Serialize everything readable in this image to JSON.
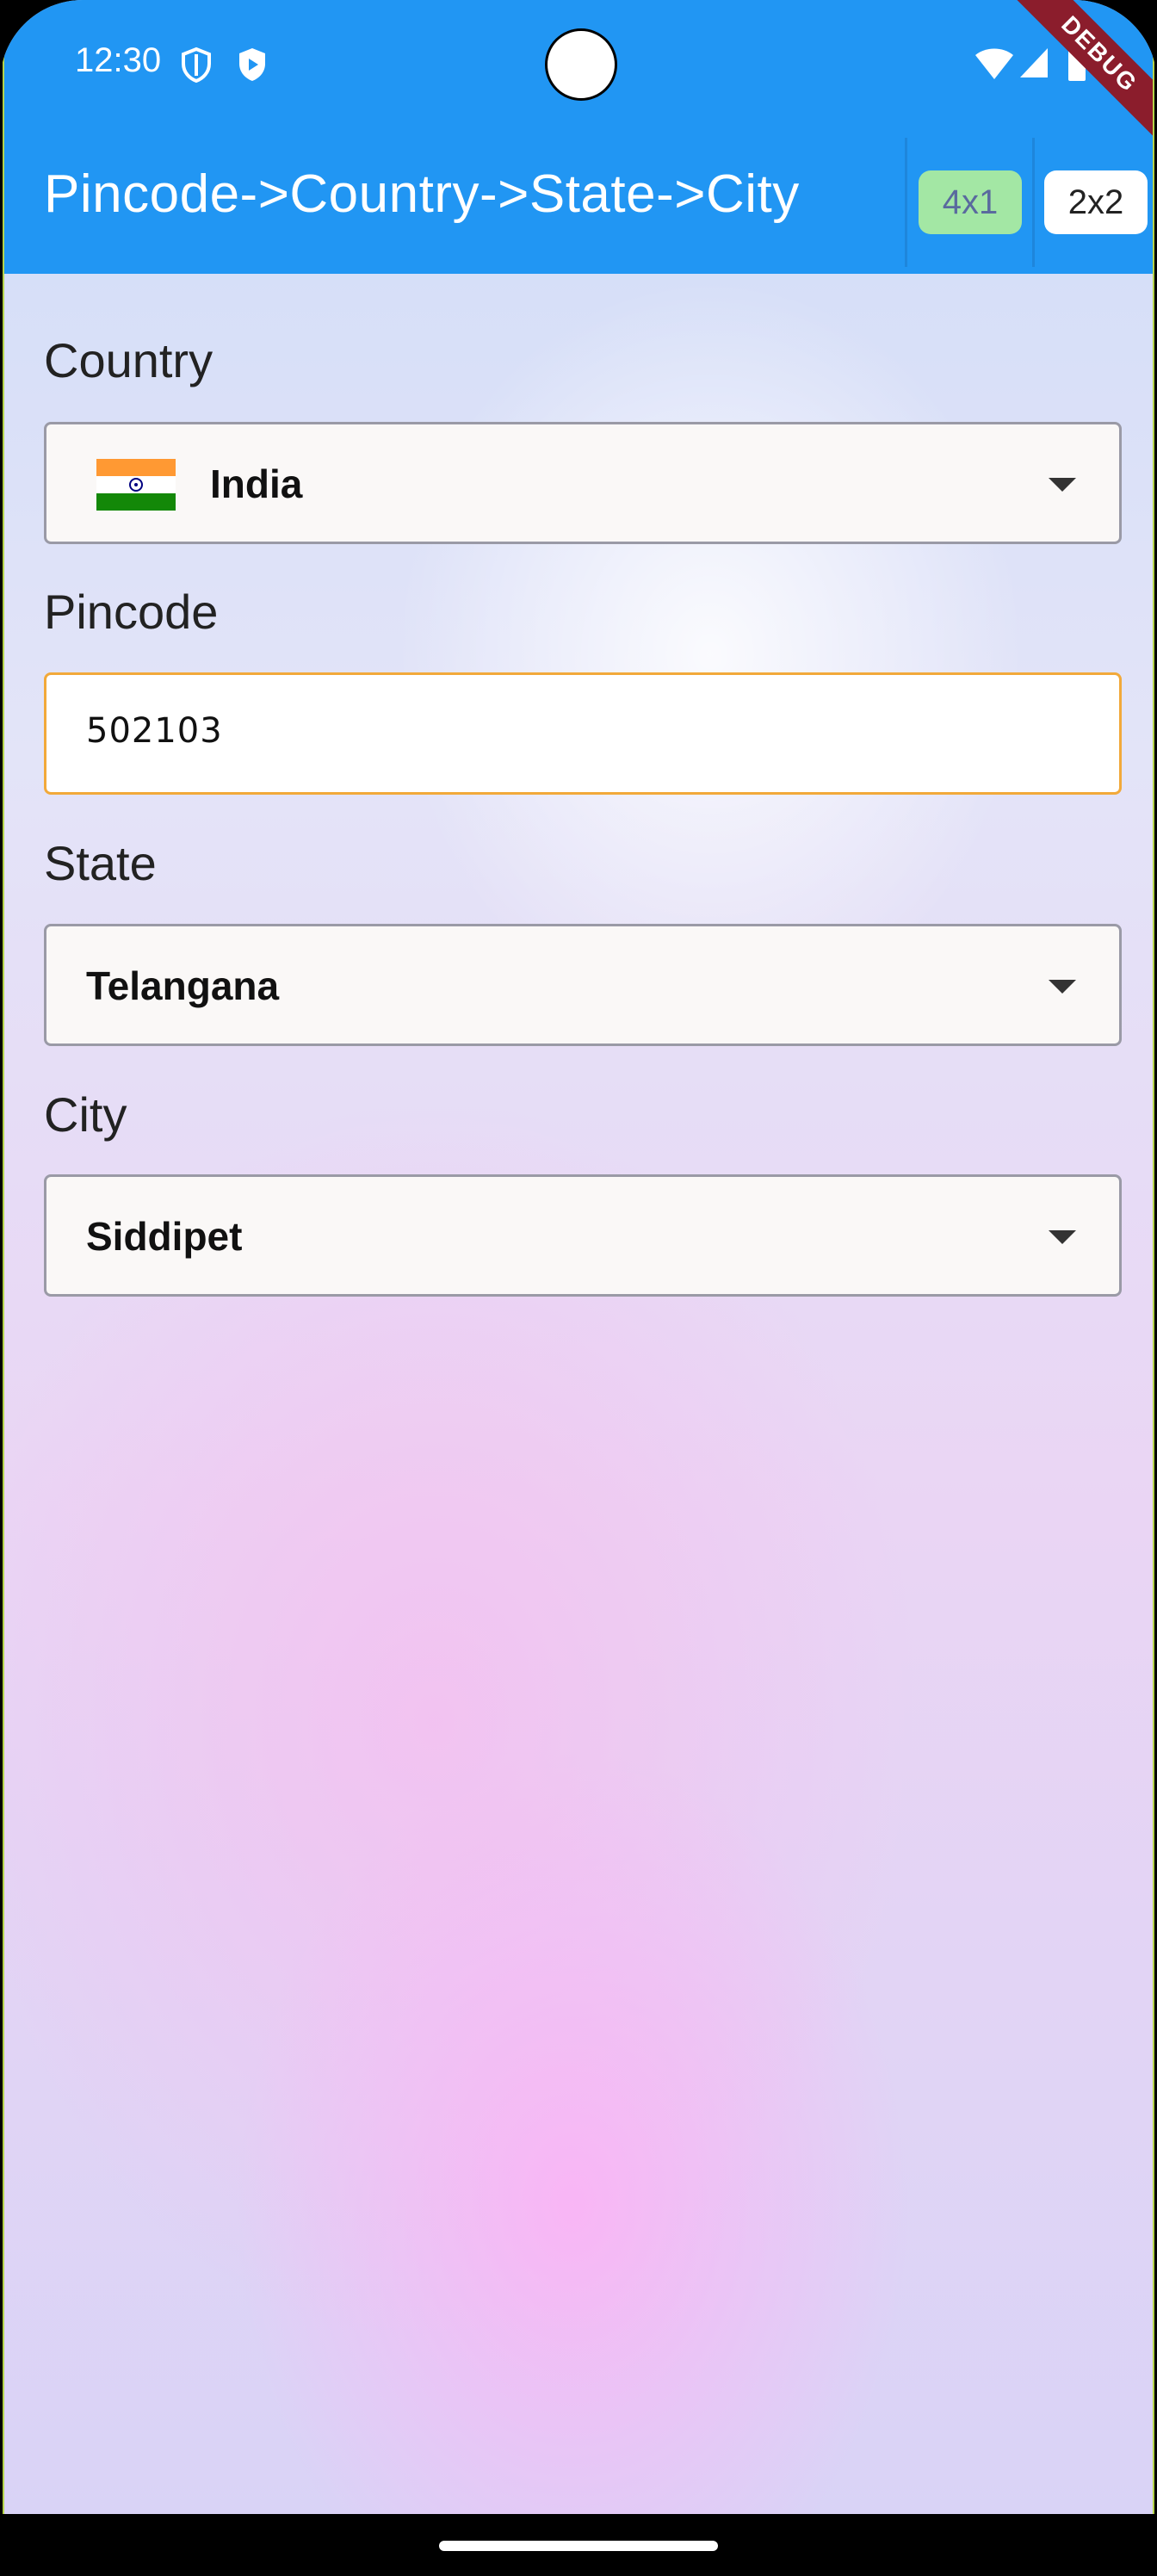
{
  "status_bar": {
    "time": "12:30"
  },
  "app_bar": {
    "title": "Pincode->Country->State->City",
    "layout_buttons": [
      {
        "label": "4x1",
        "selected": true
      },
      {
        "label": "2x2",
        "selected": false
      }
    ],
    "debug_banner": "DEBUG"
  },
  "form": {
    "country": {
      "label": "Country",
      "value": "India",
      "flag": "india-flag-icon"
    },
    "pincode": {
      "label": "Pincode",
      "value": "502103"
    },
    "state": {
      "label": "State",
      "value": "Telangana"
    },
    "city": {
      "label": "City",
      "value": "Siddipet"
    }
  },
  "colors": {
    "app_bar": "#2196f3",
    "selected_button": "#a3e7a4",
    "focused_border": "#f2a93a"
  }
}
